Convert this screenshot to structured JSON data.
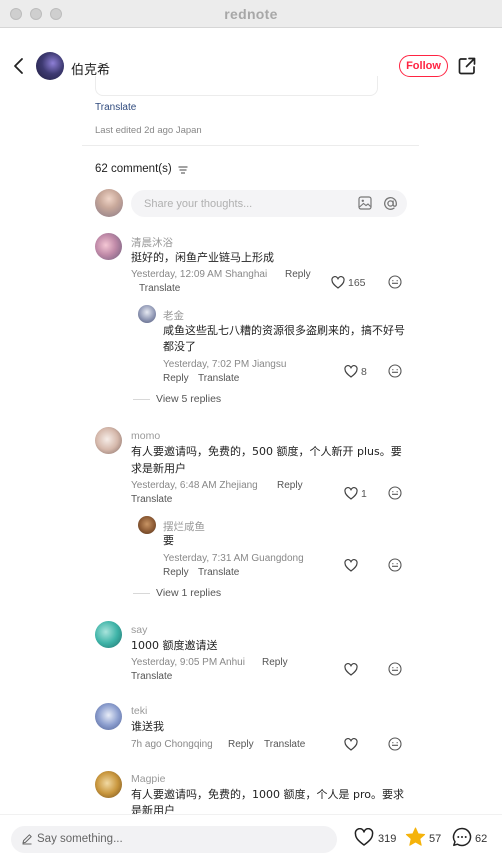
{
  "window": {
    "title": "rednote"
  },
  "header": {
    "author": "伯克希",
    "follow_label": "Follow"
  },
  "post": {
    "translate_label": "Translate",
    "last_edited": "Last edited 2d ago Japan"
  },
  "comments_header": {
    "count_label": "62 comment(s)"
  },
  "composer": {
    "placeholder": "Share your thoughts..."
  },
  "comments": [
    {
      "name": "清晨沐浴",
      "text": "挺好的，闲鱼产业链马上形成",
      "meta": "Yesterday, 12:09 AM Shanghai",
      "reply": "Reply",
      "translate": "Translate",
      "likes": "165",
      "replies": [
        {
          "name": "老金",
          "text_line1": "咸鱼这些乱七八糟的资源很多盗刷来的，搞不好号",
          "text_line2": "都没了",
          "meta": "Yesterday, 7:02 PM Jiangsu",
          "reply": "Reply",
          "translate": "Translate",
          "likes": "8"
        }
      ],
      "view_replies": "View 5 replies"
    },
    {
      "name": "momo",
      "text_line1": "有人要邀请吗，免费的，500 额度，个人新开 plus。要",
      "text_line2": "求是新用户",
      "meta": "Yesterday, 6:48 AM Zhejiang",
      "reply": "Reply",
      "translate": "Translate",
      "likes": "1",
      "replies": [
        {
          "name": "摆烂咸鱼",
          "text": "要",
          "meta": "Yesterday, 7:31 AM Guangdong",
          "reply": "Reply",
          "translate": "Translate"
        }
      ],
      "view_replies": "View 1 replies"
    },
    {
      "name": "say",
      "text": "1000 额度邀请送",
      "meta": "Yesterday, 9:05 PM Anhui",
      "reply": "Reply",
      "translate": "Translate"
    },
    {
      "name": "teki",
      "text": "谁送我",
      "meta": "7h ago Chongqing",
      "reply": "Reply",
      "translate": "Translate"
    },
    {
      "name": "Magpie",
      "text_line1": "有人要邀请吗，免费的，1000 额度，个人是 pro。要求",
      "text_line2": "是新用户"
    }
  ],
  "bottom_bar": {
    "placeholder": "Say something...",
    "likes": "319",
    "stars": "57",
    "comments": "62"
  },
  "colors": {
    "accent": "#ff2442",
    "star": "#f5b30b",
    "link": "#2f4a7d"
  }
}
